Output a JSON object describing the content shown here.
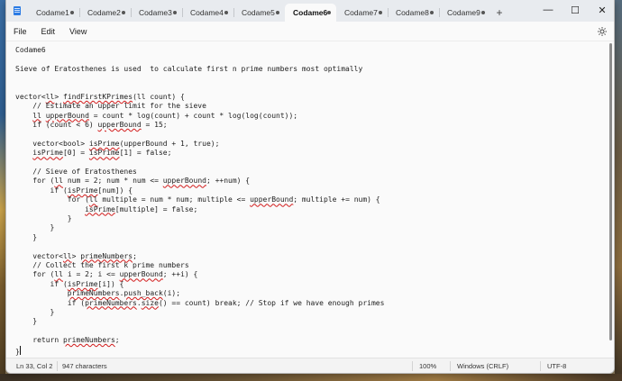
{
  "tabs": [
    {
      "label": "Codame1",
      "active": false
    },
    {
      "label": "Codame2",
      "active": false
    },
    {
      "label": "Codame3",
      "active": false
    },
    {
      "label": "Codame4",
      "active": false
    },
    {
      "label": "Codame5",
      "active": false
    },
    {
      "label": "Codame6",
      "active": true
    },
    {
      "label": "Codame7",
      "active": false
    },
    {
      "label": "Codame8",
      "active": false
    },
    {
      "label": "Codame9",
      "active": false
    }
  ],
  "new_tab_label": "+",
  "window_controls": {
    "minimize": "—",
    "maximize": "☐",
    "close": "✕"
  },
  "menu": {
    "file": "File",
    "edit": "Edit",
    "view": "View"
  },
  "editor_lines": [
    [
      {
        "t": "Codame6"
      }
    ],
    [
      {
        "t": ""
      }
    ],
    [
      {
        "t": "Sieve of Eratosthenes is used  to calculate first n prime numbers most optimally"
      }
    ],
    [
      {
        "t": ""
      }
    ],
    [
      {
        "t": ""
      }
    ],
    [
      {
        "t": "vector<"
      },
      {
        "t": "ll",
        "sq": true
      },
      {
        "t": "> "
      },
      {
        "t": "findFirstKPrimes",
        "sq": true
      },
      {
        "t": "(ll count) {"
      }
    ],
    [
      {
        "t": "    // Estimate an upper limit for the sieve"
      }
    ],
    [
      {
        "t": "    "
      },
      {
        "t": "ll",
        "sq": true
      },
      {
        "t": " "
      },
      {
        "t": "upperBound",
        "sq": true
      },
      {
        "t": " = count * log(count) + count * log(log(count));"
      }
    ],
    [
      {
        "t": "    if (count < 6) "
      },
      {
        "t": "upperBound",
        "sq": true
      },
      {
        "t": " = 15;"
      }
    ],
    [
      {
        "t": ""
      }
    ],
    [
      {
        "t": "    vector<bool> "
      },
      {
        "t": "isPrime",
        "sq": true
      },
      {
        "t": "(upperBound + 1, true);"
      }
    ],
    [
      {
        "t": "    "
      },
      {
        "t": "isPrime",
        "sq": true
      },
      {
        "t": "[0] = "
      },
      {
        "t": "isPrime",
        "sq": true
      },
      {
        "t": "[1] = false;"
      }
    ],
    [
      {
        "t": ""
      }
    ],
    [
      {
        "t": "    // Sieve of Eratosthenes"
      }
    ],
    [
      {
        "t": "    for ("
      },
      {
        "t": "ll",
        "sq": true
      },
      {
        "t": " num = 2; num * num <= "
      },
      {
        "t": "upperBound",
        "sq": true
      },
      {
        "t": "; ++num) {"
      }
    ],
    [
      {
        "t": "        if ("
      },
      {
        "t": "isPrime",
        "sq": true
      },
      {
        "t": "[num]) {"
      }
    ],
    [
      {
        "t": "            for ("
      },
      {
        "t": "ll",
        "sq": true
      },
      {
        "t": " multiple = num * num; multiple <= "
      },
      {
        "t": "upperBound",
        "sq": true
      },
      {
        "t": "; multiple += num) {"
      }
    ],
    [
      {
        "t": "                "
      },
      {
        "t": "isPrime",
        "sq": true
      },
      {
        "t": "[multiple] = false;"
      }
    ],
    [
      {
        "t": "            }"
      }
    ],
    [
      {
        "t": "        }"
      }
    ],
    [
      {
        "t": "    }"
      }
    ],
    [
      {
        "t": ""
      }
    ],
    [
      {
        "t": "    vector<"
      },
      {
        "t": "ll",
        "sq": true
      },
      {
        "t": "> "
      },
      {
        "t": "primeNumbers",
        "sq": true
      },
      {
        "t": ";"
      }
    ],
    [
      {
        "t": "    // Collect the first k prime numbers"
      }
    ],
    [
      {
        "t": "    for ("
      },
      {
        "t": "ll",
        "sq": true
      },
      {
        "t": " i = 2; i <= "
      },
      {
        "t": "upperBound",
        "sq": true
      },
      {
        "t": "; ++i) {"
      }
    ],
    [
      {
        "t": "        if ("
      },
      {
        "t": "isPrime",
        "sq": true
      },
      {
        "t": "[i]) {"
      }
    ],
    [
      {
        "t": "            "
      },
      {
        "t": "primeNumbers",
        "sq": true
      },
      {
        "t": "."
      },
      {
        "t": "push_back",
        "sq": true
      },
      {
        "t": "(i);"
      }
    ],
    [
      {
        "t": "            if ("
      },
      {
        "t": "primeNumbers",
        "sq": true
      },
      {
        "t": "."
      },
      {
        "t": "size",
        "sq": true
      },
      {
        "t": "() == count) break; // Stop if we have enough primes"
      }
    ],
    [
      {
        "t": "        }"
      }
    ],
    [
      {
        "t": "    }"
      }
    ],
    [
      {
        "t": ""
      }
    ],
    [
      {
        "t": "    return "
      },
      {
        "t": "primeNumbers",
        "sq": true
      },
      {
        "t": ";"
      }
    ],
    [
      {
        "t": "}"
      },
      {
        "caret": true
      }
    ]
  ],
  "status": {
    "position": "Ln 33, Col 2",
    "characters": "947 characters",
    "zoom": "100%",
    "line_ending": "Windows (CRLF)",
    "encoding": "UTF-8"
  },
  "icons": {
    "app": "notepad-icon",
    "settings": "gear-icon"
  }
}
